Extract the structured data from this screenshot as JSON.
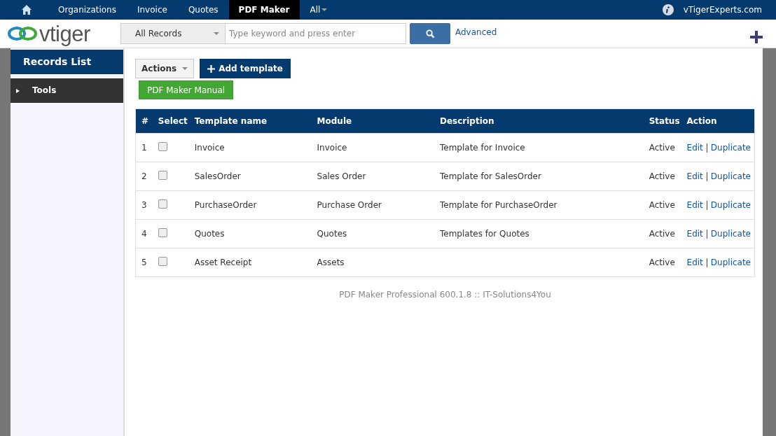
{
  "top_nav": {
    "tabs": [
      {
        "label": "Organizations",
        "selected": false
      },
      {
        "label": "Invoice",
        "selected": false
      },
      {
        "label": "Quotes",
        "selected": false
      },
      {
        "label": "PDF Maker",
        "selected": true
      },
      {
        "label": "All",
        "selected": false
      }
    ],
    "user": "vTigerExperts.com"
  },
  "header": {
    "logo": "vtiger",
    "filter": "All Records",
    "search": {
      "placeholder": "Type keyword and press enter"
    },
    "advanced": "Advanced"
  },
  "sidebar": {
    "title": "Records List",
    "items": [
      {
        "label": "Tools",
        "expanded": false
      }
    ]
  },
  "toolbar": {
    "actions": "Actions",
    "add": "Add template",
    "manual": "PDF Maker Manual"
  },
  "table": {
    "columns": [
      "#",
      "Select",
      "Template name",
      "Module",
      "Description",
      "Status",
      "Action"
    ],
    "rows": [
      {
        "num": "1",
        "checked": false,
        "name": "Invoice",
        "module": "Invoice",
        "description": "Template for Invoice",
        "status": "Active",
        "edit": "Edit",
        "duplicate": "Duplicate"
      },
      {
        "num": "2",
        "checked": false,
        "name": "SalesOrder",
        "module": "Sales Order",
        "description": "Template for SalesOrder",
        "status": "Active",
        "edit": "Edit",
        "duplicate": "Duplicate"
      },
      {
        "num": "3",
        "checked": false,
        "name": "PurchaseOrder",
        "module": "Purchase Order",
        "description": "Template for PurchaseOrder",
        "status": "Active",
        "edit": "Edit",
        "duplicate": "Duplicate"
      },
      {
        "num": "4",
        "checked": false,
        "name": "Quotes",
        "module": "Quotes",
        "description": "Templates for Quotes",
        "status": "Active",
        "edit": "Edit",
        "duplicate": "Duplicate"
      },
      {
        "num": "5",
        "checked": false,
        "name": "Asset Receipt",
        "module": "Assets",
        "status": "Active",
        "edit": "Edit",
        "duplicate": "Duplicate"
      }
    ]
  },
  "footer": "PDF Maker Professional 600.1.8 :: IT-Solutions4You"
}
